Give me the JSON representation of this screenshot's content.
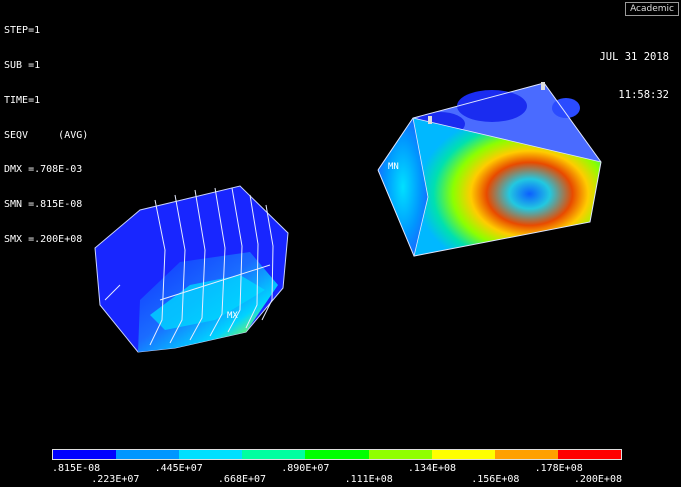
{
  "window": {
    "badge": "Academic"
  },
  "info": {
    "lines": [
      "STEP=1",
      "SUB =1",
      "TIME=1",
      "SEQV     (AVG)",
      "DMX =.708E-03",
      "SMN =.815E-08",
      "SMX =.200E+08"
    ]
  },
  "datetime": {
    "date": "JUL 31 2018",
    "time": "11:58:32"
  },
  "markers": {
    "min": "MN",
    "max": "MX"
  },
  "legend": {
    "colors": [
      "#0000ff",
      "#0096ff",
      "#00e0ff",
      "#00ffa0",
      "#00ff00",
      "#90ff00",
      "#ffff00",
      "#ffa000",
      "#ff0000"
    ],
    "labels_top": [
      ".815E-08",
      ".445E+07",
      ".890E+07",
      ".134E+08",
      ".178E+08"
    ],
    "labels_bottom": [
      ".223E+07",
      ".668E+07",
      ".111E+08",
      ".156E+08",
      ".200E+08"
    ]
  }
}
